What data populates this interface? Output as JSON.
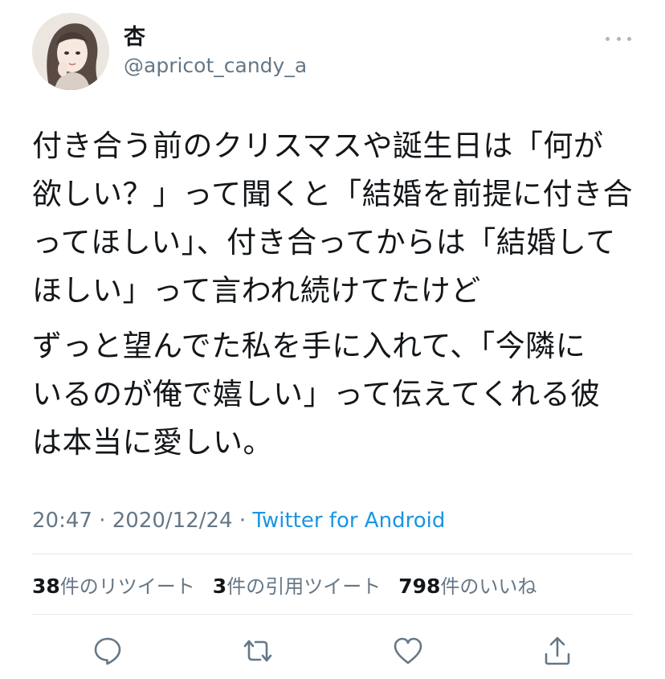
{
  "user": {
    "display_name": "杏",
    "handle": "@apricot_candy_a"
  },
  "tweet": {
    "paragraphs": [
      "付き合う前のクリスマスや誕生日は「何が\n欲しい？」って聞くと「結婚を前提に付き合\nってほしい」、付き合ってからは「結婚して\nほしい」って言われ続けてたけど",
      "ずっと望んでた私を手に入れて、「今隣に\nいるのが俺で嬉しい」って伝えてくれる彼\nは本当に愛しい。"
    ],
    "time": "20:47",
    "separator": "·",
    "date": "2020/12/24",
    "source": "Twitter for Android"
  },
  "stats": {
    "retweets_count": "38",
    "retweets_label": "件のリツイート",
    "quotes_count": "3",
    "quotes_label": "件の引用ツイート",
    "likes_count": "798",
    "likes_label": "件のいいね"
  },
  "actions": [
    "reply-icon",
    "retweet-icon",
    "like-icon",
    "share-icon"
  ],
  "colors": {
    "text": "#14171a",
    "secondary": "#657786",
    "link": "#1b95e0",
    "divider": "#e1e8ed"
  }
}
